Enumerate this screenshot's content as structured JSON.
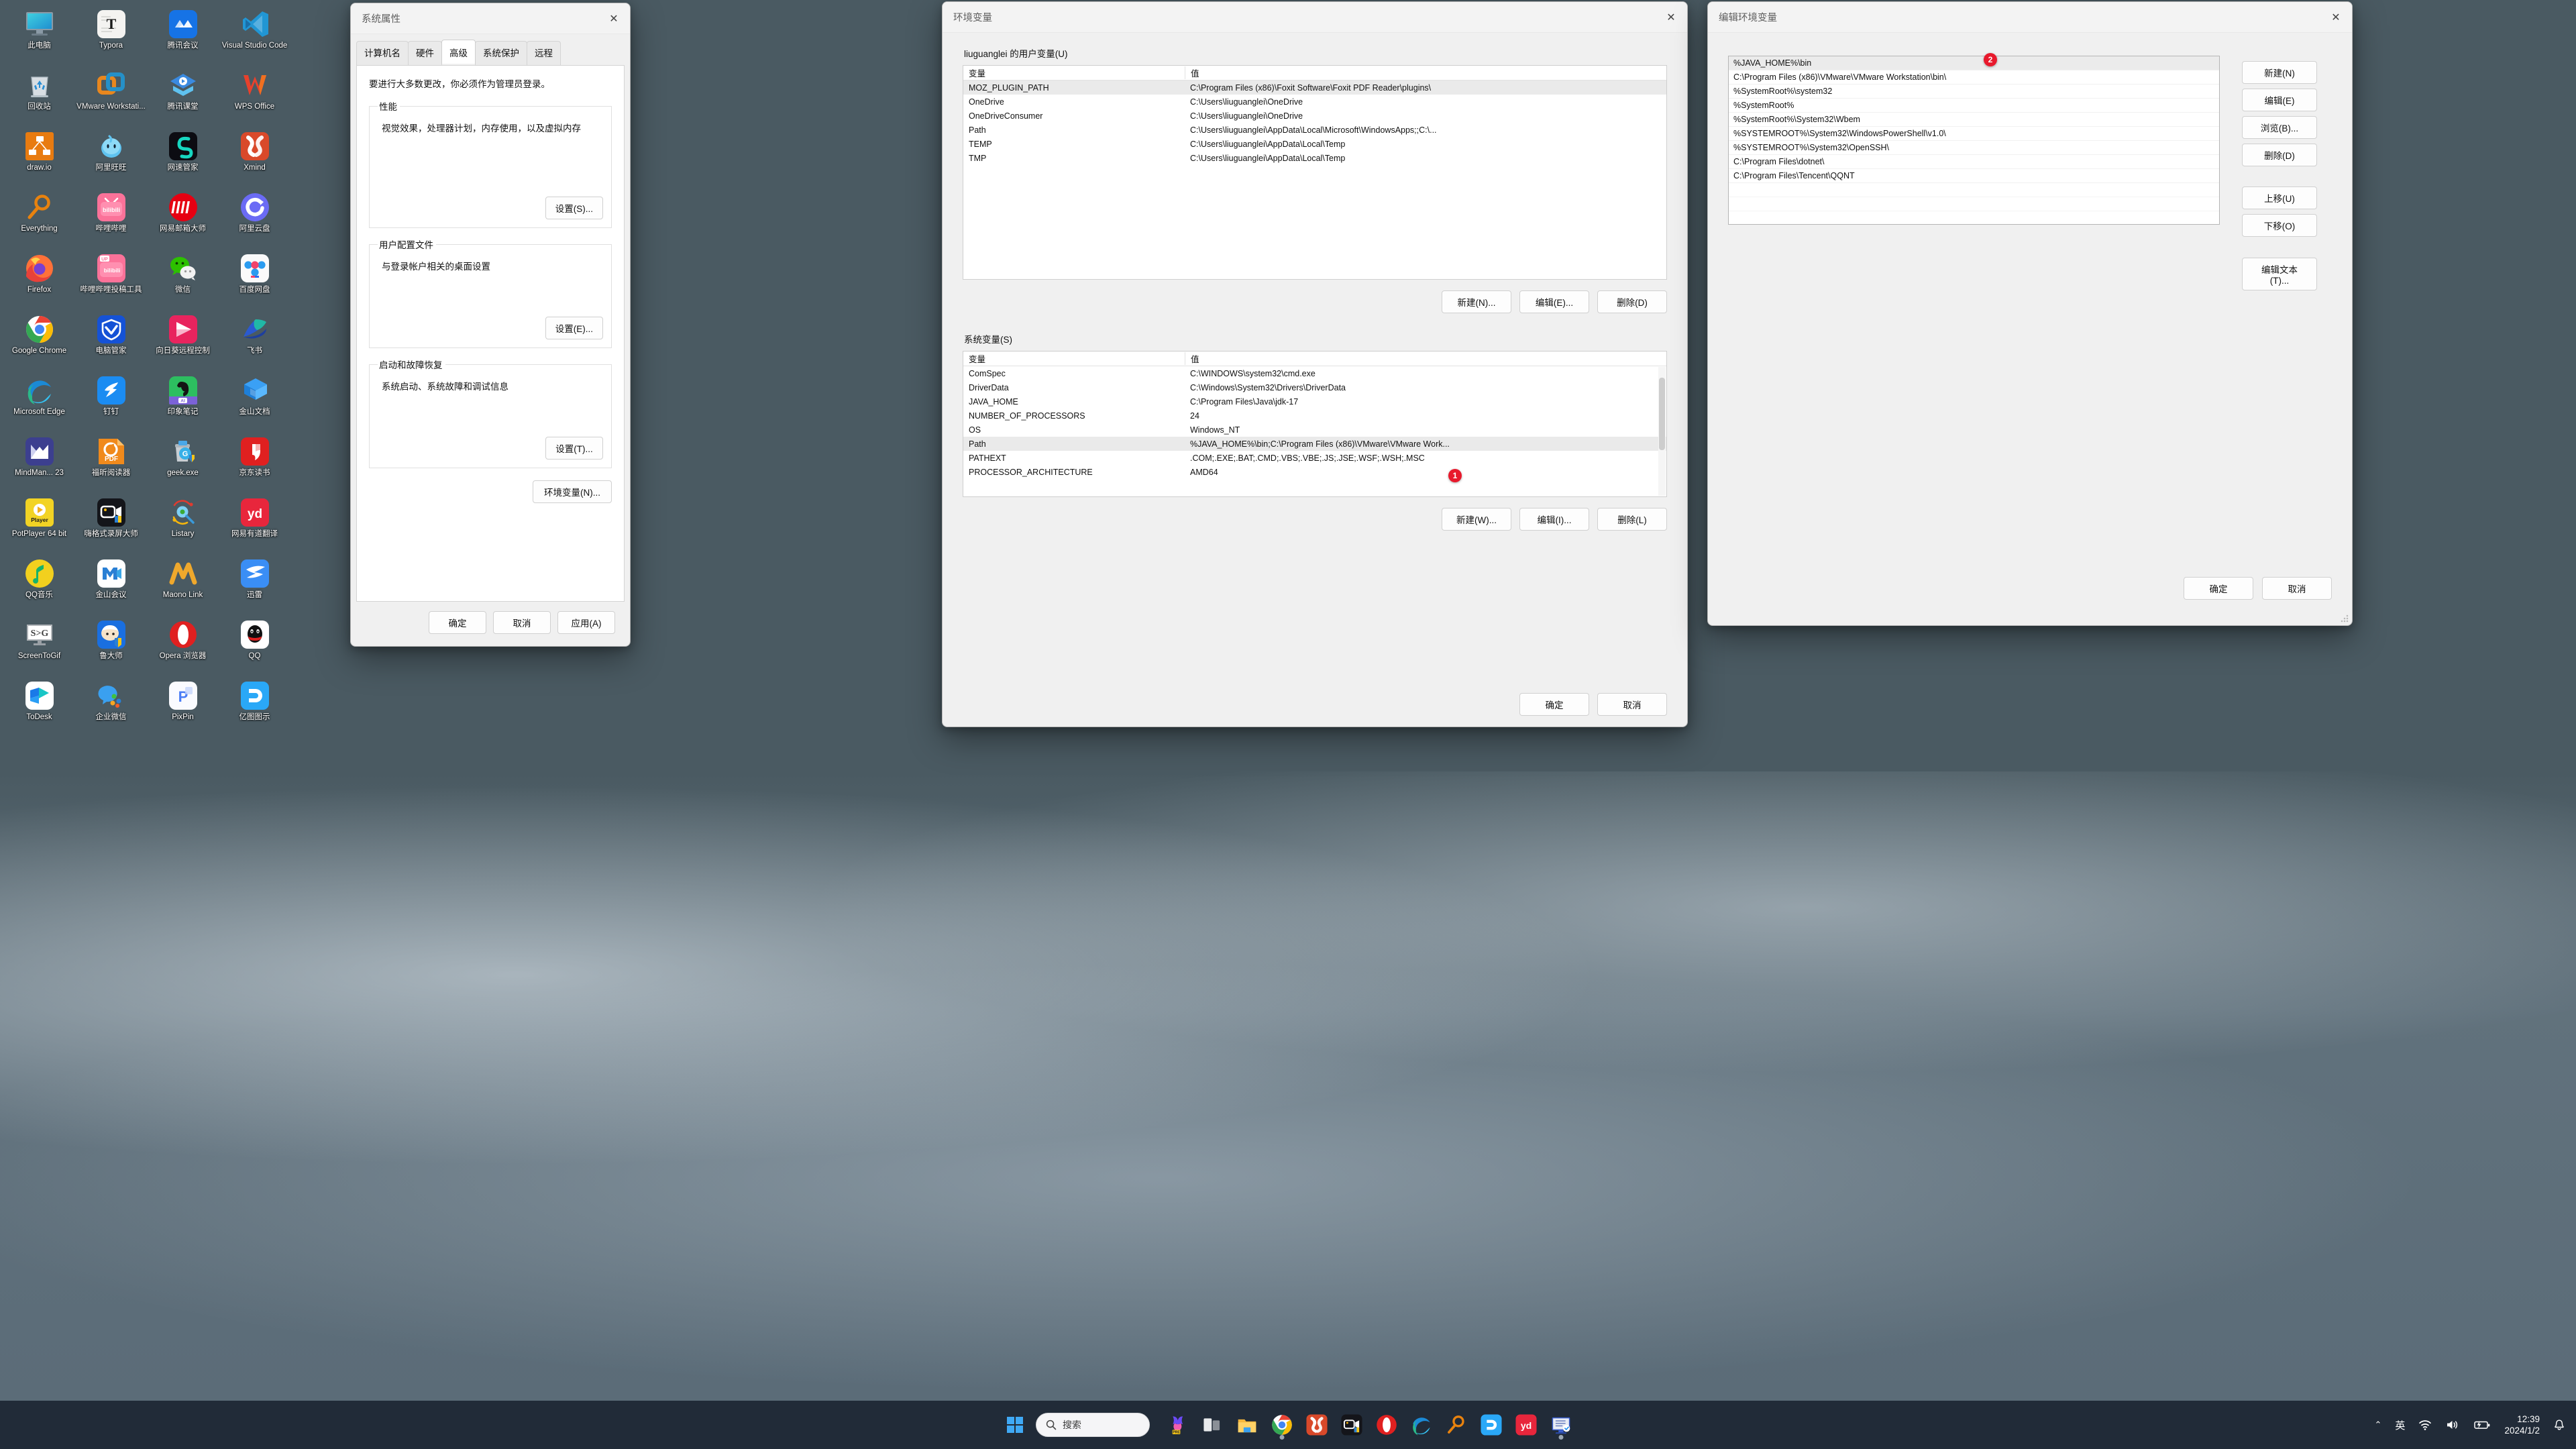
{
  "desktop": {
    "icons": [
      {
        "label": "此电脑",
        "icon": "this-pc-icon",
        "bg": "#2b9fd4",
        "kind": "monitor"
      },
      {
        "label": "Typora",
        "icon": "typora-icon",
        "bg": "#f2f2f0",
        "kind": "typora"
      },
      {
        "label": "腾讯会议",
        "icon": "tencent-meeting-icon",
        "bg": "#1668e3",
        "kind": "tmeeting"
      },
      {
        "label": "Visual Studio Code",
        "icon": "vscode-icon",
        "bg": "transparent",
        "kind": "vscode"
      },
      {
        "label": "回收站",
        "icon": "recycle-bin-icon",
        "bg": "transparent",
        "kind": "recycle"
      },
      {
        "label": "VMware Workstati...",
        "icon": "vmware-icon",
        "bg": "transparent",
        "kind": "vmware"
      },
      {
        "label": "腾讯课堂",
        "icon": "tencent-classroom-icon",
        "bg": "transparent",
        "kind": "tclass"
      },
      {
        "label": "WPS Office",
        "icon": "wps-office-icon",
        "bg": "transparent",
        "kind": "wps"
      },
      {
        "label": "draw.io",
        "icon": "drawio-icon",
        "bg": "#e87b10",
        "kind": "drawio"
      },
      {
        "label": "阿里旺旺",
        "icon": "aliwangwang-icon",
        "bg": "transparent",
        "kind": "wangwang"
      },
      {
        "label": "网速管家",
        "icon": "netspeed-icon",
        "bg": "#0c0c10",
        "kind": "netspeed"
      },
      {
        "label": "Xmind",
        "icon": "xmind-icon",
        "bg": "#d94a2b",
        "kind": "xmind"
      },
      {
        "label": "Everything",
        "icon": "everything-icon",
        "bg": "transparent",
        "kind": "everything"
      },
      {
        "label": "哔哩哔哩",
        "icon": "bilibili-icon",
        "bg": "#fb7299",
        "kind": "bilibili"
      },
      {
        "label": "网易邮箱大师",
        "icon": "netease-mail-icon",
        "bg": "#e60012",
        "kind": "neteasemail"
      },
      {
        "label": "阿里云盘",
        "icon": "aliyun-drive-icon",
        "bg": "#6b6bf5",
        "kind": "aliyundrive"
      },
      {
        "label": "Firefox",
        "icon": "firefox-icon",
        "bg": "transparent",
        "kind": "firefox"
      },
      {
        "label": "哔哩哔哩投稿工具",
        "icon": "bilibili-upload-icon",
        "bg": "#fb7299",
        "kind": "biliup"
      },
      {
        "label": "微信",
        "icon": "wechat-icon",
        "bg": "transparent",
        "kind": "wechat"
      },
      {
        "label": "百度网盘",
        "icon": "baidu-netdisk-icon",
        "bg": "#f7f7f7",
        "kind": "baidupan"
      },
      {
        "label": "Google Chrome",
        "icon": "chrome-icon",
        "bg": "transparent",
        "kind": "chrome"
      },
      {
        "label": "电脑管家",
        "icon": "pc-manager-icon",
        "bg": "#1552d6",
        "kind": "pcmgr"
      },
      {
        "label": "向日葵远程控制",
        "icon": "sunlogin-icon",
        "bg": "#e8245e",
        "kind": "sunlogin"
      },
      {
        "label": "飞书",
        "icon": "feishu-icon",
        "bg": "transparent",
        "kind": "feishu"
      },
      {
        "label": "Microsoft Edge",
        "icon": "edge-icon",
        "bg": "transparent",
        "kind": "edge"
      },
      {
        "label": "钉钉",
        "icon": "dingtalk-icon",
        "bg": "#1b8cf2",
        "kind": "dingtalk"
      },
      {
        "label": "印象笔记",
        "icon": "evernote-icon",
        "bg": "#2dbe60",
        "kind": "evernote"
      },
      {
        "label": "金山文档",
        "icon": "kingsoft-docs-icon",
        "bg": "transparent",
        "kind": "ksdoc"
      },
      {
        "label": "MindMan... 23",
        "icon": "mindmanager-icon",
        "bg": "#3c3f8f",
        "kind": "mindmanager"
      },
      {
        "label": "福昕阅读器",
        "icon": "foxit-reader-icon",
        "bg": "#f08a1c",
        "kind": "foxit"
      },
      {
        "label": "geek.exe",
        "icon": "geek-uninstaller-icon",
        "bg": "transparent",
        "kind": "geek"
      },
      {
        "label": "京东读书",
        "icon": "jd-read-icon",
        "bg": "#e02020",
        "kind": "jdread"
      },
      {
        "label": "PotPlayer 64 bit",
        "icon": "potplayer-icon",
        "bg": "#f2d324",
        "kind": "potplayer"
      },
      {
        "label": "嗨格式录屏大师",
        "icon": "higeshi-recorder-icon",
        "bg": "#14151a",
        "kind": "higeshi"
      },
      {
        "label": "Listary",
        "icon": "listary-icon",
        "bg": "transparent",
        "kind": "listary"
      },
      {
        "label": "网易有道翻译",
        "icon": "youdao-translate-icon",
        "bg": "#e8263c",
        "kind": "youdao"
      },
      {
        "label": "QQ音乐",
        "icon": "qq-music-icon",
        "bg": "#f2d01e",
        "kind": "qqmusic"
      },
      {
        "label": "金山会议",
        "icon": "kingsoft-meeting-icon",
        "bg": "#ffffff",
        "kind": "ksmeeting"
      },
      {
        "label": "Maono Link",
        "icon": "maono-link-icon",
        "bg": "transparent",
        "kind": "maono"
      },
      {
        "label": "迅雷",
        "icon": "thunder-icon",
        "bg": "#3a8ef5",
        "kind": "thunder"
      },
      {
        "label": "ScreenToGif",
        "icon": "screentogif-icon",
        "bg": "#ffffff",
        "kind": "s2g"
      },
      {
        "label": "鲁大师",
        "icon": "ludashi-icon",
        "bg": "#1a6fe0",
        "kind": "ludashi"
      },
      {
        "label": "Opera 浏览器",
        "icon": "opera-icon",
        "bg": "transparent",
        "kind": "opera"
      },
      {
        "label": "QQ",
        "icon": "qq-icon",
        "bg": "#ffffff",
        "kind": "qq"
      },
      {
        "label": "ToDesk",
        "icon": "todesk-icon",
        "bg": "#ffffff",
        "kind": "todesk"
      },
      {
        "label": "企业微信",
        "icon": "wecom-icon",
        "bg": "transparent",
        "kind": "wecom"
      },
      {
        "label": "PixPin",
        "icon": "pixpin-icon",
        "bg": "#fafbff",
        "kind": "pixpin"
      },
      {
        "label": "亿图图示",
        "icon": "edraw-icon",
        "bg": "#2aa8f7",
        "kind": "edraw"
      }
    ]
  },
  "system_properties": {
    "title": "系统属性",
    "close_label": "✕",
    "tabs": [
      {
        "label": "计算机名"
      },
      {
        "label": "硬件"
      },
      {
        "label": "高级"
      },
      {
        "label": "系统保护"
      },
      {
        "label": "远程"
      }
    ],
    "active_tab_index": 2,
    "hint": "要进行大多数更改，你必须作为管理员登录。",
    "groups": [
      {
        "legend": "性能",
        "desc": "视觉效果，处理器计划，内存使用，以及虚拟内存",
        "button": "设置(S)..."
      },
      {
        "legend": "用户配置文件",
        "desc": "与登录帐户相关的桌面设置",
        "button": "设置(E)..."
      },
      {
        "legend": "启动和故障恢复",
        "desc": "系统启动、系统故障和调试信息",
        "button": "设置(T)..."
      }
    ],
    "env_button": "环境变量(N)...",
    "footer": {
      "ok": "确定",
      "cancel": "取消",
      "apply": "应用(A)"
    }
  },
  "environment_variables": {
    "title": "环境变量",
    "close_label": "✕",
    "user_section": {
      "legend": "liuguanglei 的用户变量(U)",
      "columns": [
        "变量",
        "值"
      ],
      "rows": [
        {
          "name": "MOZ_PLUGIN_PATH",
          "value": "C:\\Program Files (x86)\\Foxit Software\\Foxit PDF Reader\\plugins\\",
          "selected": true
        },
        {
          "name": "OneDrive",
          "value": "C:\\Users\\liuguanglei\\OneDrive",
          "selected": false
        },
        {
          "name": "OneDriveConsumer",
          "value": "C:\\Users\\liuguanglei\\OneDrive",
          "selected": false
        },
        {
          "name": "Path",
          "value": "C:\\Users\\liuguanglei\\AppData\\Local\\Microsoft\\WindowsApps;;C:\\...",
          "selected": false
        },
        {
          "name": "TEMP",
          "value": "C:\\Users\\liuguanglei\\AppData\\Local\\Temp",
          "selected": false
        },
        {
          "name": "TMP",
          "value": "C:\\Users\\liuguanglei\\AppData\\Local\\Temp",
          "selected": false
        }
      ],
      "buttons": {
        "new": "新建(N)...",
        "edit": "编辑(E)...",
        "delete": "删除(D)"
      }
    },
    "system_section": {
      "legend": "系统变量(S)",
      "columns": [
        "变量",
        "值"
      ],
      "rows": [
        {
          "name": "ComSpec",
          "value": "C:\\WINDOWS\\system32\\cmd.exe",
          "selected": false
        },
        {
          "name": "DriverData",
          "value": "C:\\Windows\\System32\\Drivers\\DriverData",
          "selected": false
        },
        {
          "name": "JAVA_HOME",
          "value": "C:\\Program Files\\Java\\jdk-17",
          "selected": false
        },
        {
          "name": "NUMBER_OF_PROCESSORS",
          "value": "24",
          "selected": false
        },
        {
          "name": "OS",
          "value": "Windows_NT",
          "selected": false
        },
        {
          "name": "Path",
          "value": "%JAVA_HOME%\\bin;C:\\Program Files (x86)\\VMware\\VMware Work...",
          "selected": true
        },
        {
          "name": "PATHEXT",
          "value": ".COM;.EXE;.BAT;.CMD;.VBS;.VBE;.JS;.JSE;.WSF;.WSH;.MSC",
          "selected": false
        },
        {
          "name": "PROCESSOR_ARCHITECTURE",
          "value": "AMD64",
          "selected": false
        }
      ],
      "buttons": {
        "new": "新建(W)...",
        "edit": "编辑(I)...",
        "delete": "删除(L)"
      }
    },
    "footer": {
      "ok": "确定",
      "cancel": "取消"
    },
    "badge": "1"
  },
  "edit_environment_variable": {
    "title": "编辑环境变量",
    "close_label": "✕",
    "entries": [
      {
        "value": "%JAVA_HOME%\\bin",
        "selected": true
      },
      {
        "value": "C:\\Program Files (x86)\\VMware\\VMware Workstation\\bin\\",
        "selected": false
      },
      {
        "value": "%SystemRoot%\\system32",
        "selected": false
      },
      {
        "value": "%SystemRoot%",
        "selected": false
      },
      {
        "value": "%SystemRoot%\\System32\\Wbem",
        "selected": false
      },
      {
        "value": "%SYSTEMROOT%\\System32\\WindowsPowerShell\\v1.0\\",
        "selected": false
      },
      {
        "value": "%SYSTEMROOT%\\System32\\OpenSSH\\",
        "selected": false
      },
      {
        "value": "C:\\Program Files\\dotnet\\",
        "selected": false
      },
      {
        "value": "C:\\Program Files\\Tencent\\QQNT",
        "selected": false
      }
    ],
    "side_buttons": [
      {
        "label": "新建(N)",
        "name": "new-button"
      },
      {
        "label": "编辑(E)",
        "name": "edit-button"
      },
      {
        "label": "浏览(B)...",
        "name": "browse-button"
      },
      {
        "label": "删除(D)",
        "name": "delete-button"
      },
      {
        "label": "上移(U)",
        "name": "move-up-button"
      },
      {
        "label": "下移(O)",
        "name": "move-down-button"
      },
      {
        "label": "编辑文本(T)...",
        "name": "edit-text-button"
      }
    ],
    "footer": {
      "ok": "确定",
      "cancel": "取消"
    },
    "badge": "2"
  },
  "taskbar": {
    "start_label": "开始",
    "search_placeholder": "搜索",
    "items": [
      {
        "name": "copilot-icon",
        "kind": "copilot",
        "running": false
      },
      {
        "name": "task-view-icon",
        "kind": "taskview",
        "running": false
      },
      {
        "name": "file-explorer-icon",
        "kind": "explorer",
        "running": false
      },
      {
        "name": "chrome-icon",
        "kind": "chrome",
        "running": true
      },
      {
        "name": "xmind-icon",
        "kind": "xmind",
        "running": false
      },
      {
        "name": "higeshi-recorder-icon",
        "kind": "higeshi",
        "running": false
      },
      {
        "name": "opera-icon",
        "kind": "opera",
        "running": false
      },
      {
        "name": "edge-icon",
        "kind": "edge",
        "running": false
      },
      {
        "name": "everything-icon",
        "kind": "everything",
        "running": false
      },
      {
        "name": "edraw-icon",
        "kind": "edraw",
        "running": false
      },
      {
        "name": "youdao-translate-icon",
        "kind": "youdao",
        "running": false
      },
      {
        "name": "system-properties-icon",
        "kind": "sysprop",
        "running": true
      }
    ],
    "tray": {
      "overflow": "⌃",
      "ime": "英",
      "wifi": "wifi-icon",
      "volume": "volume-icon",
      "battery": "battery-icon",
      "time": "12:39",
      "date": "2024/1/2",
      "notification": "bell-icon"
    }
  }
}
